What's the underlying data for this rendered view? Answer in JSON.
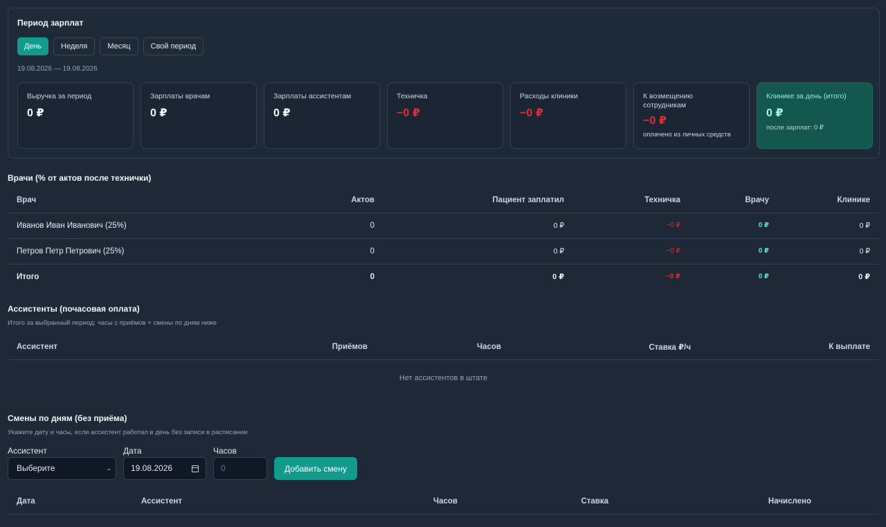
{
  "period": {
    "title": "Период зарплат",
    "tabs": [
      "День",
      "Неделя",
      "Месяц",
      "Свой период"
    ],
    "active_tab": "День",
    "range": "19.08.2026 — 19.08.2026"
  },
  "stats": [
    {
      "label": "Выручка за период",
      "value": "0 ₽",
      "tone": "normal"
    },
    {
      "label": "Зарплаты врачам",
      "value": "0 ₽",
      "tone": "normal"
    },
    {
      "label": "Зарплаты ассистентам",
      "value": "0 ₽",
      "tone": "normal"
    },
    {
      "label": "Техничка",
      "value": "−0 ₽",
      "tone": "negative"
    },
    {
      "label": "Расходы клиники",
      "value": "−0 ₽",
      "tone": "negative"
    },
    {
      "label": "К возмещению сотрудникам",
      "value": "−0 ₽",
      "tone": "negative",
      "sub": "оплачено из личных средств"
    },
    {
      "label": "Клинике за день (итого)",
      "value": "0 ₽",
      "tone": "highlight",
      "sub": "после зарплат: 0 ₽"
    }
  ],
  "doctors": {
    "title": "Врачи (% от актов после технички)",
    "columns": [
      "Врач",
      "Актов",
      "Пациент заплатил",
      "Техничка",
      "Врачу",
      "Клинике"
    ],
    "rows": [
      {
        "name": "Иванов Иван Иванович (25%)",
        "acts": "0",
        "paid": "0 ₽",
        "tech": "−0 ₽",
        "doctor": "0 ₽",
        "clinic": "0 ₽"
      },
      {
        "name": "Петров Петр Петрович (25%)",
        "acts": "0",
        "paid": "0 ₽",
        "tech": "−0 ₽",
        "doctor": "0 ₽",
        "clinic": "0 ₽"
      }
    ],
    "total": {
      "name": "Итого",
      "acts": "0",
      "paid": "0 ₽",
      "tech": "−0 ₽",
      "doctor": "0 ₽",
      "clinic": "0 ₽"
    }
  },
  "assistants": {
    "title": "Ассистенты (почасовая оплата)",
    "subtitle": "Итого за выбранный период: часы с приёмов + смены по дням ниже",
    "columns": [
      "Ассистент",
      "Приёмов",
      "Часов",
      "Ставка ₽/ч",
      "К выплате"
    ],
    "empty": "Нет ассистентов в штате"
  },
  "shifts": {
    "title": "Смены по дням (без приёма)",
    "subtitle": "Укажите дату и часы, если ассистент работал в день без записи в расписании",
    "assistant_label": "Ассистент",
    "assistant_value": "Выберите",
    "date_label": "Дата",
    "date_value": "19.08.2026",
    "hours_label": "Часов",
    "hours_placeholder": "0",
    "add_button": "Добавить смену",
    "columns": [
      "Дата",
      "Ассистент",
      "Часов",
      "Ставка",
      "Начислено"
    ]
  },
  "colors": {
    "accent": "#129a8c",
    "negative": "#e02d3c",
    "positive": "#5fe0c9",
    "highlight_card": "#14574f"
  }
}
